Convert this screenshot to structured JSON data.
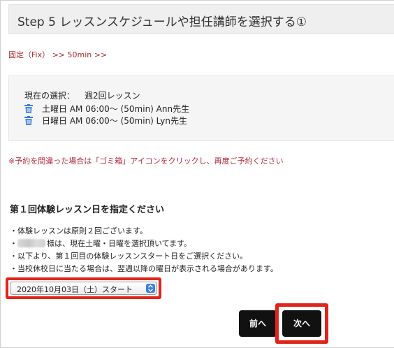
{
  "header": {
    "title": "Step 5 レッスンスケジュールや担任講師を選択する①"
  },
  "breadcrumb": {
    "text": "固定（Fix） >> 50min >>"
  },
  "selection": {
    "label": "現在の選択：",
    "plan": "週2回レッスン",
    "lessons": [
      {
        "icon": "trash-icon",
        "text": "土曜日 AM 06:00～ (50min) Ann先生"
      },
      {
        "icon": "trash-icon",
        "text": "日曜日 AM 06:00～ (50min) Lyn先生"
      }
    ]
  },
  "notice": {
    "text": "※予約を間違った場合は「ゴミ箱」アイコンをクリックし、再度ご予約ください"
  },
  "first_lesson": {
    "heading": "第１回体験レッスン日を指定ください",
    "lines": [
      "・体験レッスンは原則２回ございます。",
      "様は、現在土曜・日曜を選択頂いてます。",
      "・以下より、第１回目の体験レッスンスタート日をご選択ください。",
      "・当校休校日に当たる場合は、翌週以降の曜日が表示される場合があります。"
    ],
    "line2_prefix": "・",
    "select_value": "2020年10月03日（土）スタート"
  },
  "buttons": {
    "prev": "前へ",
    "next": "次へ"
  },
  "colors": {
    "accent_red": "#e2231a",
    "notice_red": "#b2273a",
    "breadcrumb": "#a52a2a",
    "trash_blue": "#3d7ed1",
    "button_bg": "#111111"
  }
}
